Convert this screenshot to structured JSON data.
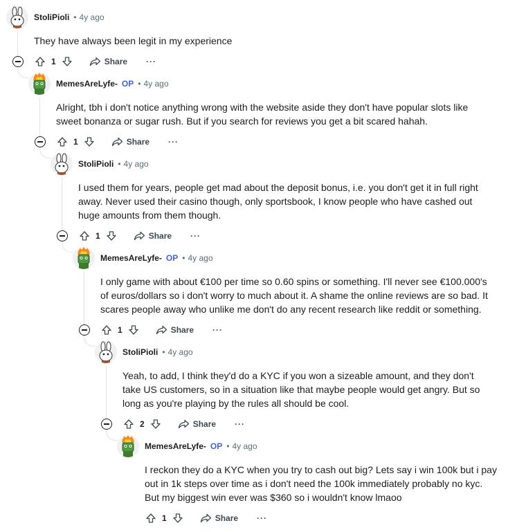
{
  "comments": [
    {
      "author": "StoliPioli",
      "op_label": "",
      "separator": "•",
      "time": "4y ago",
      "avatar_icon": "bunny-avatar-icon",
      "body": [
        "They have always been legit in my experience"
      ],
      "score": "1",
      "share_label": "Share",
      "more_label": "···"
    },
    {
      "author": "MemesAreLyfe-",
      "op_label": "OP",
      "separator": "•",
      "time": "4y ago",
      "avatar_icon": "flaming-robot-avatar-icon",
      "body": [
        "Alright, tbh i don't notice anything wrong with the website aside they don't have popular slots like",
        "sweet bonanza or sugar rush. But if you search for reviews you get a bit scared hahah."
      ],
      "score": "1",
      "share_label": "Share",
      "more_label": "···"
    },
    {
      "author": "StoliPioli",
      "op_label": "",
      "separator": "•",
      "time": "4y ago",
      "avatar_icon": "bunny-avatar-icon",
      "body": [
        "I used them for years, people get mad about the deposit bonus, i.e. you don't get it in full right",
        "away. Never used their casino though, only sportsbook, I know people who have cashed out",
        "huge amounts from them though."
      ],
      "score": "1",
      "share_label": "Share",
      "more_label": "···"
    },
    {
      "author": "MemesAreLyfe-",
      "op_label": "OP",
      "separator": "•",
      "time": "4y ago",
      "avatar_icon": "flaming-robot-avatar-icon",
      "body": [
        "I only game with about €100 per time so 0.60 spins or something. I'll never see €100.000's",
        "of euros/dollars so i don't worry to much about it. A shame the online reviews are so bad. It",
        "scares people away who unlike me don't do any recent research like reddit or something."
      ],
      "score": "1",
      "share_label": "Share",
      "more_label": "···"
    },
    {
      "author": "StoliPioli",
      "op_label": "",
      "separator": "•",
      "time": "4y ago",
      "avatar_icon": "bunny-avatar-icon",
      "body": [
        "Yeah, to add, I think they'd do a KYC if you won a sizeable amount, and they don't",
        "take US customers, so in a situation like that maybe people would get angry. But so",
        "long as you're playing by the rules all should be cool."
      ],
      "score": "2",
      "share_label": "Share",
      "more_label": "···"
    },
    {
      "author": "MemesAreLyfe-",
      "op_label": "OP",
      "separator": "•",
      "time": "4y ago",
      "avatar_icon": "flaming-robot-avatar-icon",
      "body": [
        "I reckon they do a KYC when you try to cash out big? Lets say i win 100k but i pay",
        "out in 1k steps over time as i don't need the 100k immediately probably no kyc.",
        "But my biggest win ever was $360 so i wouldn't know lmaoo"
      ],
      "score": "1",
      "share_label": "Share",
      "more_label": "···"
    }
  ]
}
